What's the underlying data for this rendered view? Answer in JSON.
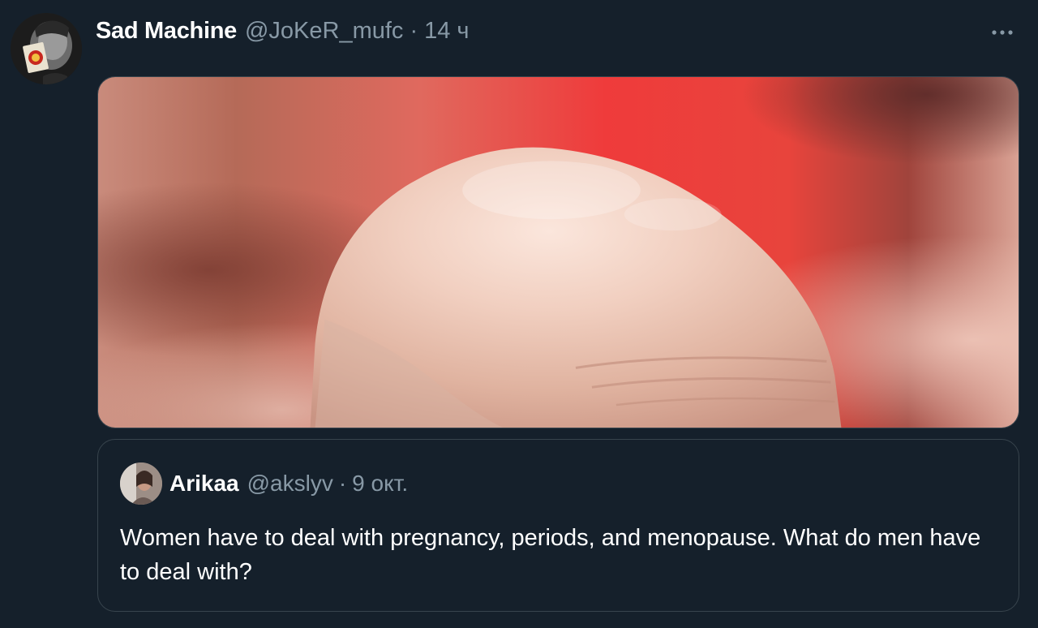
{
  "tweet": {
    "display_name": "Sad Machine",
    "handle": "@JoKeR_mufc",
    "separator": "·",
    "time": "14 ч",
    "more_icon": "more-horizontal-icon",
    "media_alt": "photo"
  },
  "quoted_tweet": {
    "display_name": "Arikaa",
    "handle": "@akslyv",
    "separator": "·",
    "time": "9 окт.",
    "text": "Women have to deal with pregnancy, periods, and menopause. What do men have to deal with?"
  },
  "colors": {
    "background": "#15202b",
    "secondary_text": "#8899a6",
    "border": "#38444d",
    "primary_text": "#ffffff"
  }
}
